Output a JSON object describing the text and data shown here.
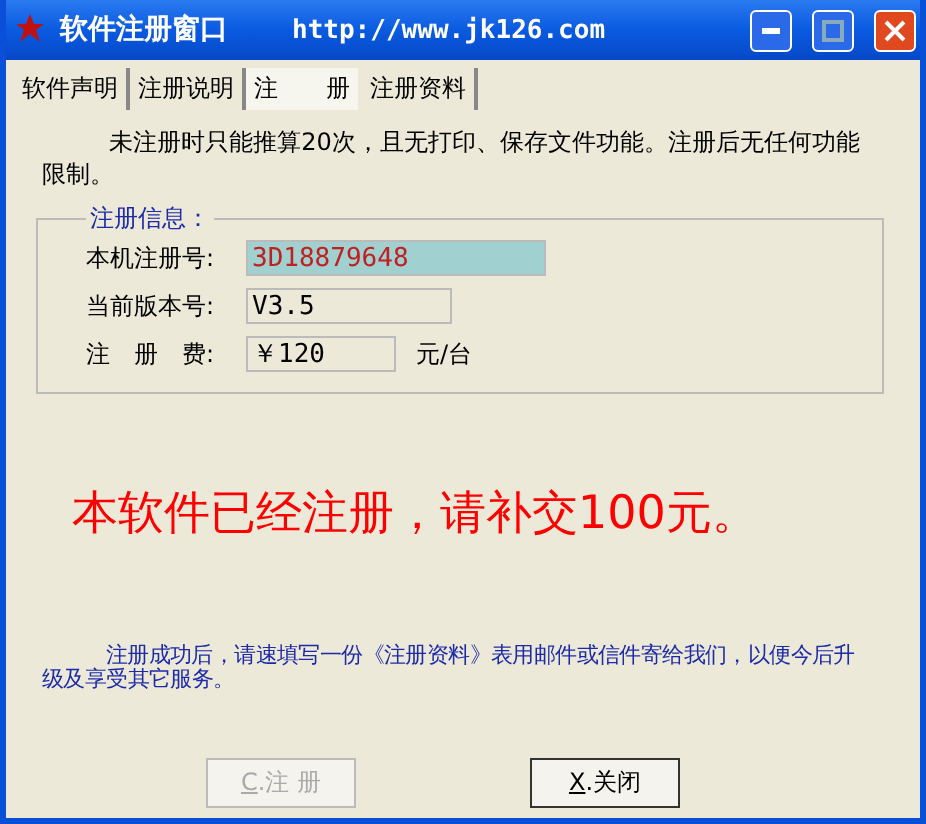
{
  "window": {
    "title": "软件注册窗口",
    "url": "http://www.jk126.com"
  },
  "tabs": [
    {
      "label": "软件声明",
      "selected": false
    },
    {
      "label": "注册说明",
      "selected": false
    },
    {
      "label": "注　　册",
      "selected": true
    },
    {
      "label": "注册资料",
      "selected": false
    }
  ],
  "notice": "未注册时只能推算20次，且无打印、保存文件功能。注册后无任何功能限制。",
  "group": {
    "title": "注册信息：",
    "fields": [
      {
        "label": "本机注册号:",
        "value": "3D18879648",
        "highlighted": true
      },
      {
        "label": "当前版本号:",
        "value": "V3.5",
        "highlighted": false
      },
      {
        "label": "注　册　费:",
        "value": "￥120",
        "highlighted": false,
        "unit": "元/台"
      }
    ]
  },
  "status_message": "本软件已经注册，请补交100元。",
  "footer_note": "注册成功后，请速填写一份《注册资料》表用邮件或信件寄给我们，以便今后升级及享受其它服务。",
  "buttons": [
    {
      "label": "C.注 册",
      "disabled": true
    },
    {
      "label": "X.关闭",
      "disabled": false
    }
  ]
}
